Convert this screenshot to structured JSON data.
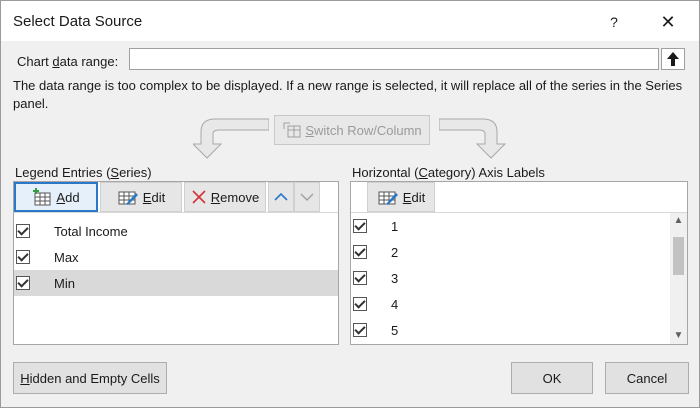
{
  "window": {
    "title": "Select Data Source",
    "help_glyph": "?",
    "close_glyph": "✕"
  },
  "range": {
    "label_pre": "Chart ",
    "label_u": "d",
    "label_post": "ata range:",
    "value": ""
  },
  "info_text": "The data range is too complex to be displayed. If a new range is selected, it will replace all of the series in the Series panel.",
  "switch": {
    "label_u": "S",
    "label_rest": "witch Row/Column"
  },
  "legend": {
    "title_pre": "Legend Entries (",
    "title_u": "S",
    "title_post": "eries)",
    "add_u": "A",
    "add_rest": "dd",
    "edit_u": "E",
    "edit_rest": "dit",
    "remove_u": "R",
    "remove_rest": "emove",
    "items": [
      "Total Income",
      "Max",
      "Min"
    ]
  },
  "axis": {
    "title_pre": "Horizontal (",
    "title_u": "C",
    "title_post": "ategory) Axis Labels",
    "edit_u": "E",
    "edit_rest": "dit",
    "items": [
      "1",
      "2",
      "3",
      "4",
      "5"
    ]
  },
  "buttons": {
    "hidden_u": "H",
    "hidden_rest": "idden and Empty Cells",
    "ok": "OK",
    "cancel": "Cancel"
  },
  "colors": {
    "accent": "#2b78c9",
    "remove_x": "#d13438",
    "up_arrow": "#2b78c9"
  }
}
